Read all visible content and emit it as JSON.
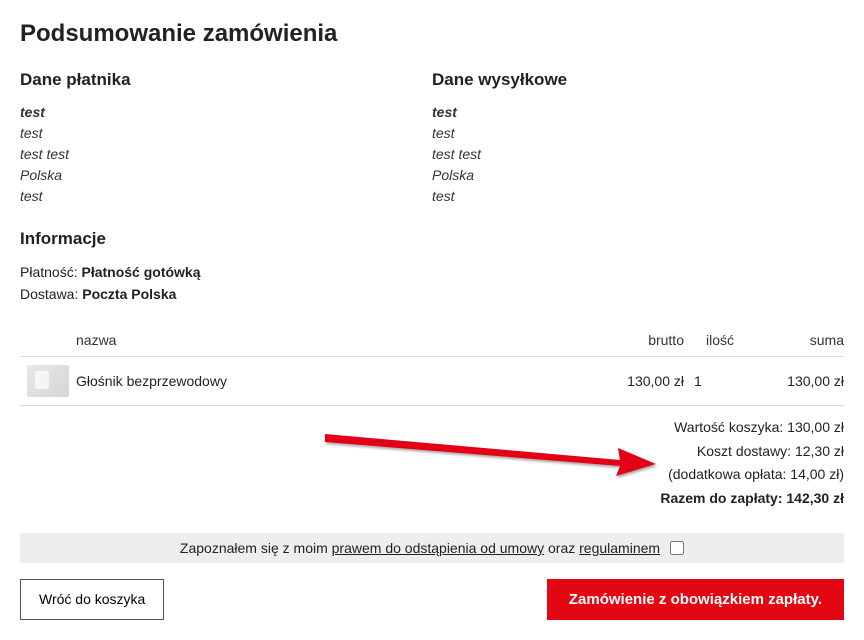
{
  "title": "Podsumowanie zamówienia",
  "payer": {
    "heading": "Dane płatnika",
    "lines": [
      "test",
      "test",
      "test test",
      "Polska",
      "test"
    ]
  },
  "shipping": {
    "heading": "Dane wysyłkowe",
    "lines": [
      "test",
      "test",
      "test test",
      "Polska",
      "test"
    ]
  },
  "info": {
    "heading": "Informacje",
    "payment_label": "Płatność: ",
    "payment_value": "Płatność gotówką",
    "delivery_label": "Dostawa: ",
    "delivery_value": "Poczta Polska"
  },
  "table": {
    "headers": {
      "name": "nazwa",
      "brutto": "brutto",
      "qty": "ilość",
      "sum": "suma"
    },
    "row": {
      "name": "Głośnik bezprzewodowy",
      "brutto": "130,00 zł",
      "qty": "1",
      "sum": "130,00 zł"
    }
  },
  "totals": {
    "cart_value": "Wartość koszyka: 130,00 zł",
    "delivery_cost": "Koszt dostawy: 12,30 zł",
    "extra_fee": "(dodatkowa opłata: 14,00 zł)",
    "grand_total": "Razem do zapłaty: 142,30 zł"
  },
  "consent": {
    "prefix": "Zapoznałem się z moim ",
    "withdrawal": "prawem do odstąpienia od umowy",
    "mid": " oraz ",
    "terms": "regulaminem"
  },
  "buttons": {
    "back": "Wróć do koszyka",
    "order": "Zamówienie z obowiązkiem zapłaty."
  }
}
